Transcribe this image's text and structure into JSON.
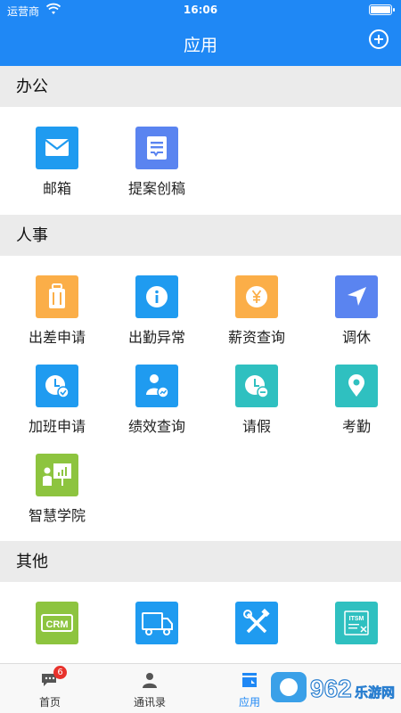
{
  "status": {
    "carrier": "运营商",
    "time": "16:06"
  },
  "header": {
    "title": "应用"
  },
  "sections": {
    "office": {
      "title": "办公",
      "apps": [
        "邮箱",
        "提案创稿"
      ]
    },
    "hr": {
      "title": "人事",
      "apps": [
        "出差申请",
        "出勤异常",
        "薪资查询",
        "调休",
        "加班申请",
        "绩效查询",
        "请假",
        "考勤",
        "智慧学院"
      ]
    },
    "other": {
      "title": "其他",
      "apps": [
        "CRM",
        "",
        "",
        "ITSM"
      ]
    }
  },
  "tabs": [
    {
      "label": "首页",
      "badge": "6"
    },
    {
      "label": "通讯录"
    },
    {
      "label": "应用"
    },
    {
      "label": ""
    }
  ],
  "watermark": {
    "text": "962",
    "sub": "乐游网"
  },
  "colors": {
    "accent": "#1f88f5",
    "orange": "#fbae48",
    "teal": "#2fc0c0",
    "indigo": "#5a84f0",
    "green": "#8dc43f"
  }
}
